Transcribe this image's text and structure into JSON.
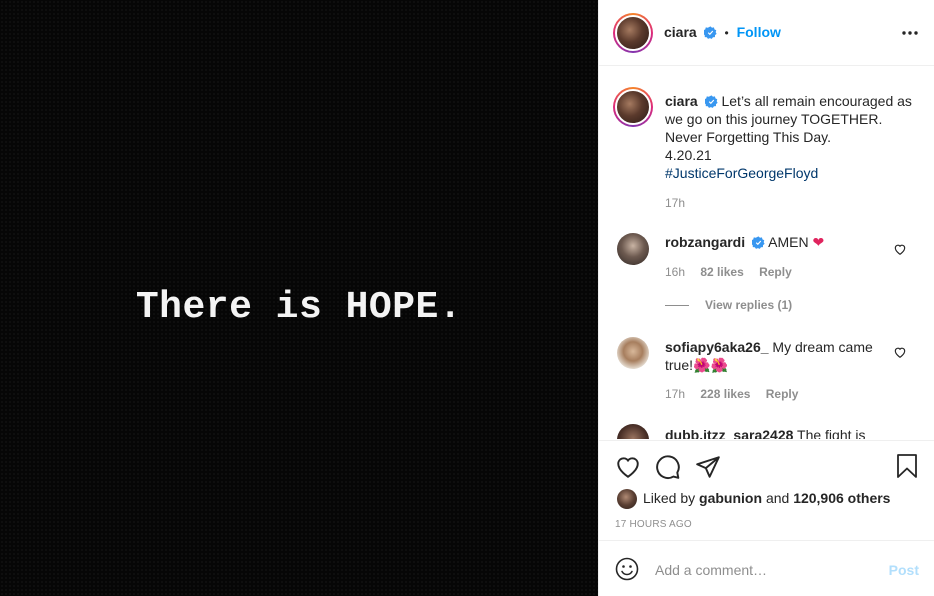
{
  "media": {
    "text": "There is HOPE."
  },
  "header": {
    "username": "ciara",
    "separator": "•",
    "follow_label": "Follow",
    "more_icon": "more-options-icon"
  },
  "caption": {
    "username": "ciara",
    "line1": "Let’s all remain encouraged as",
    "line2": "we go on this journey TOGETHER.",
    "line3": "Never Forgetting This Day.",
    "line4": "4.20.21",
    "hashtag": "#JusticeForGeorgeFloyd",
    "age": "17h"
  },
  "comments": [
    {
      "username": "robzangardi",
      "verified": true,
      "text": "AMEN",
      "emoji": "❤",
      "age": "16h",
      "likes": "82 likes",
      "reply_label": "Reply",
      "view_replies": "View replies (1)"
    },
    {
      "username": "sofiapy6aka26_",
      "verified": false,
      "text_line1": "My dream came",
      "text_line2": "true!",
      "emoji": "🌺🌺",
      "age": "17h",
      "likes": "228 likes",
      "reply_label": "Reply"
    },
    {
      "username": "dubb.itzz_sara2428",
      "text": "The fight is"
    }
  ],
  "actions": {
    "liked_by_prefix": "Liked by",
    "liked_by_user": "gabunion",
    "liked_by_and": "and",
    "liked_by_others": "120,906 others",
    "timestamp": "17 HOURS AGO"
  },
  "add_comment": {
    "placeholder": "Add a comment…",
    "post_label": "Post"
  },
  "colors": {
    "accent": "#0095f6",
    "hashtag": "#00376b",
    "muted": "#8e8e8e",
    "heart": "#ed4956"
  }
}
